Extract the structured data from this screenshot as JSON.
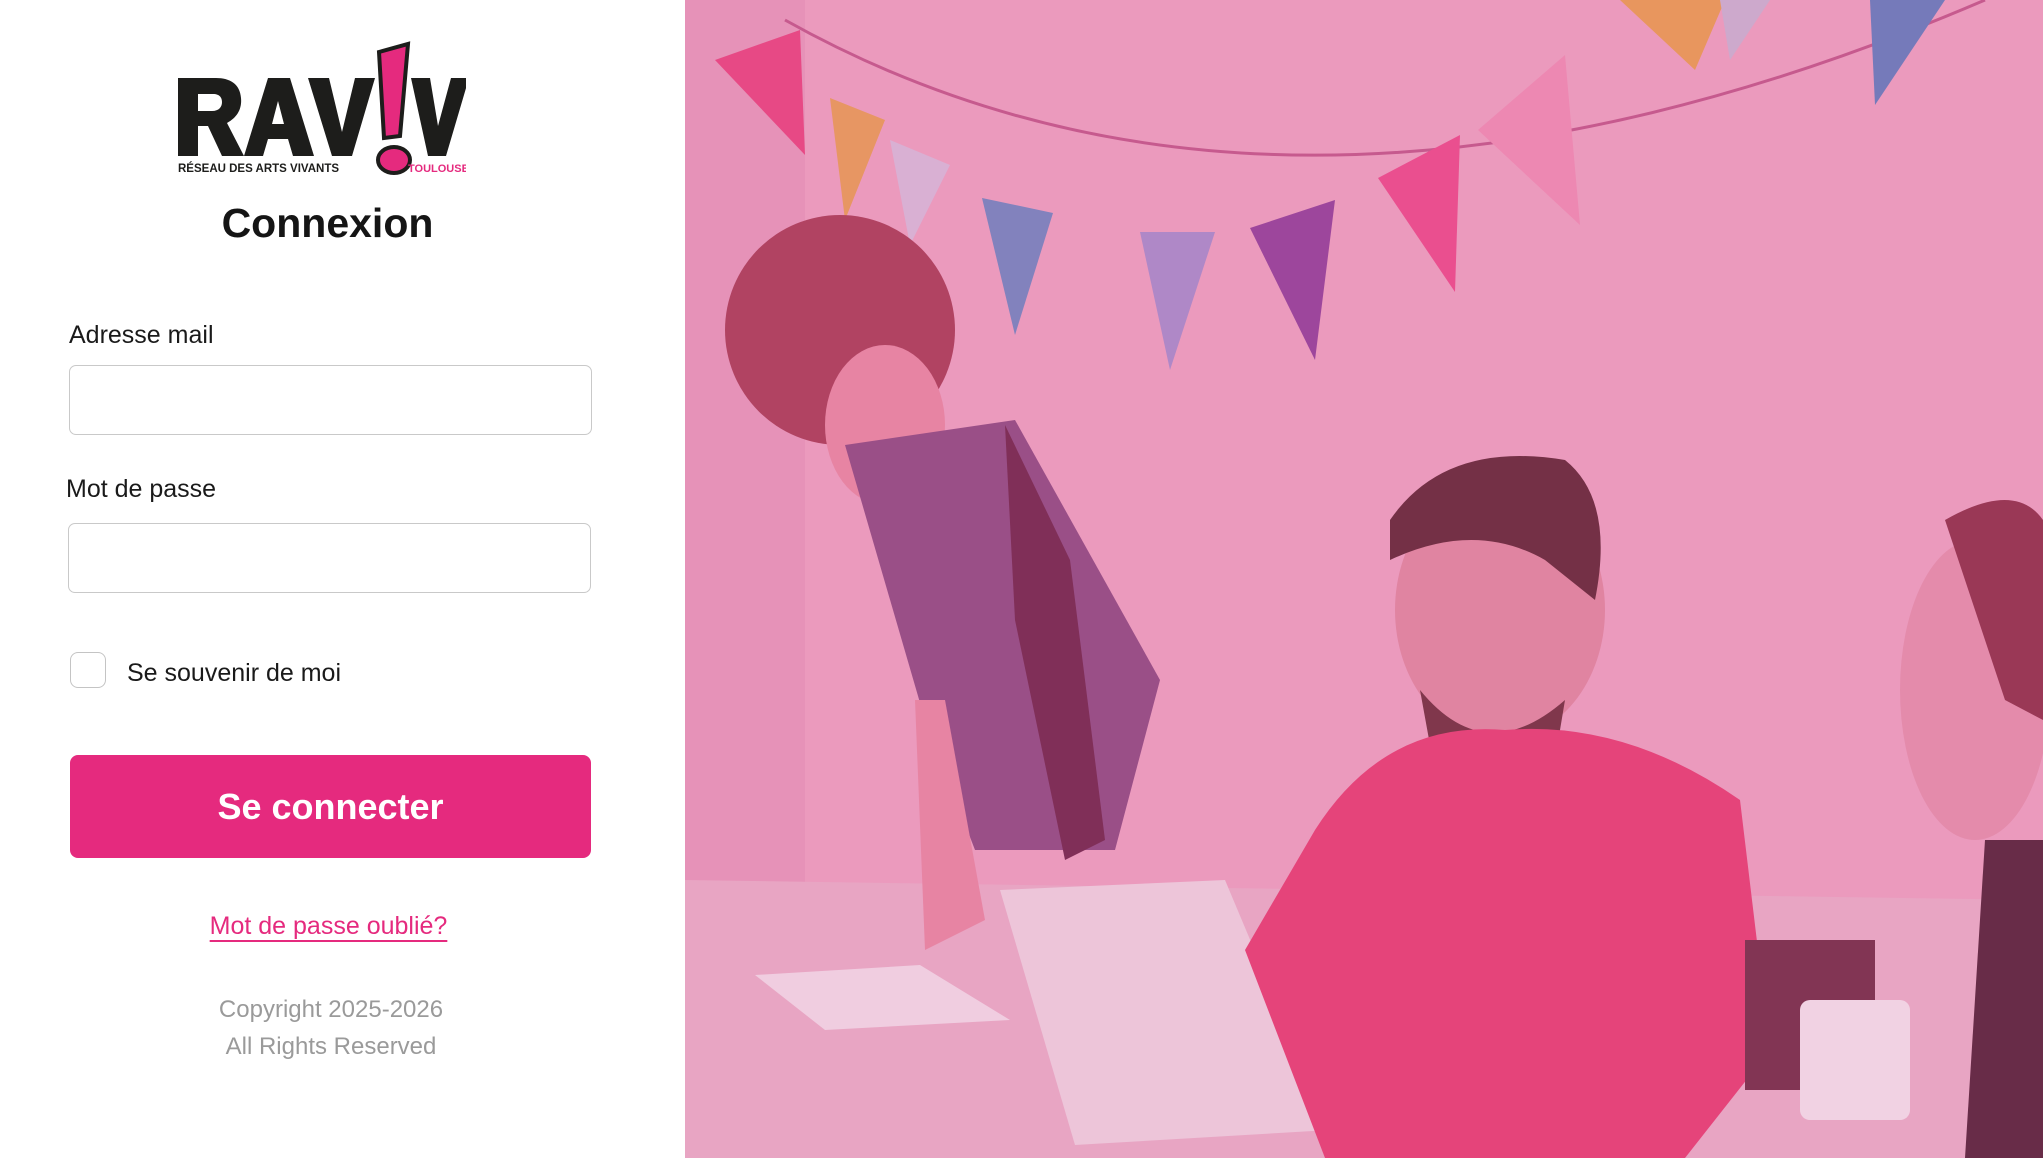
{
  "brand": {
    "logo_text": "RAV!V",
    "logo_subtitle": "RÉSEAU DES ARTS VIVANTS",
    "logo_city": "TOULOUSE"
  },
  "login": {
    "title": "Connexion",
    "email_label": "Adresse mail",
    "email_value": "",
    "password_label": "Mot de passe",
    "password_value": "",
    "remember_label": "Se souvenir de moi",
    "remember_checked": false,
    "submit_label": "Se connecter",
    "forgot_label": "Mot de passe oublié?"
  },
  "footer": {
    "copyright_line1": "Copyright 2025-2026",
    "copyright_line2": "All Rights Reserved"
  },
  "colors": {
    "accent": "#e52a7e",
    "photo_overlay": "#e66aa0"
  },
  "hero_image": {
    "icon": "team-meeting-photo"
  }
}
